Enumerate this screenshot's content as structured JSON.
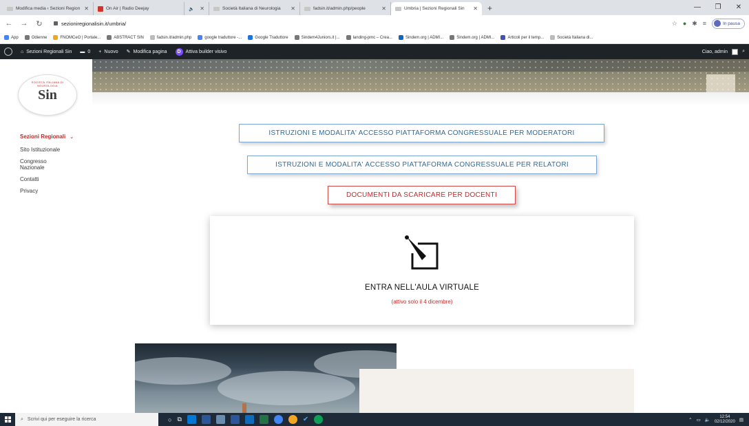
{
  "browser": {
    "tabs": [
      {
        "title": "Modifica media ‹ Sezioni Region"
      },
      {
        "title": "On Air | Radio Deejay"
      },
      {
        "title": ""
      },
      {
        "title": "Società Italiana di Neurologia"
      },
      {
        "title": "fadsin.it/admin.php/people"
      },
      {
        "title": "Umbria | Sezioni Regionali Sin"
      }
    ],
    "url": "sezioniregionalisin.it/umbria/",
    "profile_status": "In pausa",
    "bookmarks": [
      "App",
      "Odienne",
      "FNOMCeO | Portale...",
      "ABSTRACT SIN",
      "fadsin.it/admin.php",
      "google traduttore -...",
      "Google Traduttore",
      "Sindem4Juniors.it |...",
      "landing-pmc – Crea...",
      "Sindem.org | ADMI...",
      "Sindem.org | ADMI...",
      "Articoli per il temp...",
      "Società Italiana di..."
    ]
  },
  "wp_admin": {
    "site_name": "Sezioni Regionali Sin",
    "comments_count": "0",
    "new_label": "Nuovo",
    "edit_label": "Modifica pagina",
    "builder_label": "Attiva builder visivo",
    "greeting": "Ciao, admin"
  },
  "site": {
    "logo_text": "Sin",
    "logo_arc_text": "SOCIETÀ ITALIANA DI NEUROLOGIA",
    "menu": [
      {
        "label": "Sezioni Regionali"
      },
      {
        "label": "Sito Istituzionale"
      },
      {
        "label": "Congresso Nazionale"
      },
      {
        "label": "Contatti"
      },
      {
        "label": "Privacy"
      }
    ]
  },
  "content": {
    "btn_moderators": "ISTRUZIONI E MODALITA' ACCESSO PIATTAFORMA CONGRESSUALE PER MODERATORI",
    "btn_speakers": "ISTRUZIONI E MODALITA' ACCESSO PIATTAFORMA CONGRESSUALE PER RELATORI",
    "btn_documents": "DOCUMENTI DA SCARICARE PER DOCENTI",
    "card_title": "ENTRA NELL'AULA VIRTUALE",
    "card_subtitle": "(attivo solo il 4 dicembre)"
  },
  "taskbar": {
    "search_placeholder": "Scrivi qui per eseguire la ricerca",
    "time": "12:54",
    "date": "02/12/2020"
  },
  "colors": {
    "accent_red": "#c62828",
    "accent_blue": "#2f6a9a",
    "wp_bar": "#1d2327"
  }
}
